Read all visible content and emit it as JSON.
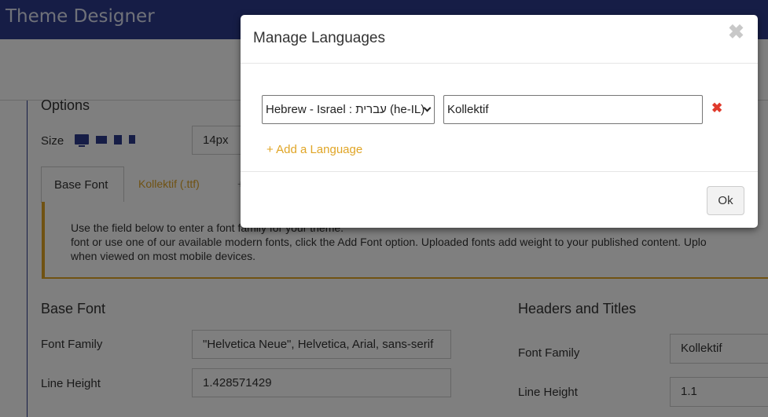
{
  "app": {
    "title": "Theme Designer"
  },
  "options": {
    "title": "Options",
    "size_label": "Size",
    "size_value": "14px",
    "devices": [
      "desktop-icon",
      "laptop-icon",
      "tablet-icon",
      "phone-icon"
    ]
  },
  "tabs": [
    {
      "label": "Base Font",
      "active": true
    },
    {
      "label": "Kollektif (.ttf)",
      "active": false
    },
    {
      "label": "+",
      "active": false
    }
  ],
  "notice": {
    "line1": "Use the field below to enter a font family for your theme.",
    "line2": "font or use one of our available modern fonts, click the Add Font option. Uploaded fonts add weight to your published content. Uplo",
    "line3": "when viewed on most mobile devices."
  },
  "base_font": {
    "title": "Base Font",
    "font_family_label": "Font Family",
    "font_family_value": "\"Helvetica Neue\", Helvetica, Arial, sans-serif",
    "line_height_label": "Line Height",
    "line_height_value": "1.428571429"
  },
  "headers_titles": {
    "title": "Headers and Titles",
    "font_family_label": "Font Family",
    "font_family_value": "Kollektif",
    "line_height_label": "Line Height",
    "line_height_value": "1.1"
  },
  "modal": {
    "title": "Manage Languages",
    "close_glyph": "✖",
    "language_selected": "Hebrew - Israel : עברית (he-IL)",
    "font_value": "Kollektif",
    "remove_glyph": "✖",
    "add_language": "+ Add a Language",
    "ok_label": "Ok"
  },
  "colors": {
    "topbar": "#2d3a8c",
    "accent": "#e0a526",
    "danger": "#e03a2c"
  }
}
